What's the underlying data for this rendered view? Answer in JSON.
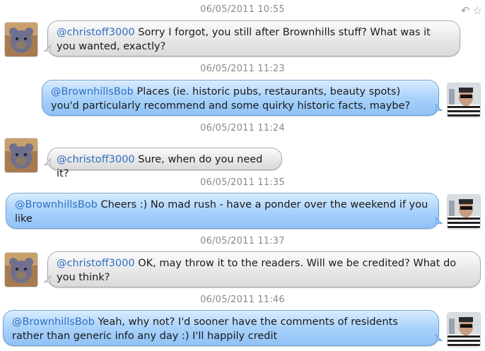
{
  "toolbar": {
    "reply_icon": "reply-icon",
    "star_icon": "star-icon"
  },
  "messages": [
    {
      "time": "06/05/2011 10:55",
      "direction": "in",
      "handle": "@christoff3000",
      "text": " Sorry I forgot, you still after Brownhills stuff? What was it you wanted, exactly?"
    },
    {
      "time": "06/05/2011 11:23",
      "direction": "out",
      "handle": "@BrownhillsBob",
      "text": " Places (ie. historic pubs, restaurants, beauty spots) you'd particularly recommend and some quirky historic facts, maybe?"
    },
    {
      "time": "06/05/2011 11:24",
      "direction": "in",
      "handle": "@christoff3000",
      "text": " Sure, when do you need it?"
    },
    {
      "time": "06/05/2011 11:35",
      "direction": "out",
      "handle": "@BrownhillsBob",
      "text": " Cheers :) No mad rush - have a ponder over the weekend if you like"
    },
    {
      "time": "06/05/2011 11:37",
      "direction": "in",
      "handle": "@christoff3000",
      "text": " OK, may throw it to the readers. Will we be credited? What do you think?"
    },
    {
      "time": "06/05/2011 11:46",
      "direction": "out",
      "handle": "@BrownhillsBob",
      "text": " Yeah, why not? I'd sooner have the comments of residents rather than generic info any day :) I'll happily credit"
    }
  ],
  "colors": {
    "mention": "#2f6fc4",
    "timestamp": "#8a8a8a",
    "outgoing_bubble": "#a9d2fb",
    "incoming_bubble": "#e7e7e7"
  }
}
